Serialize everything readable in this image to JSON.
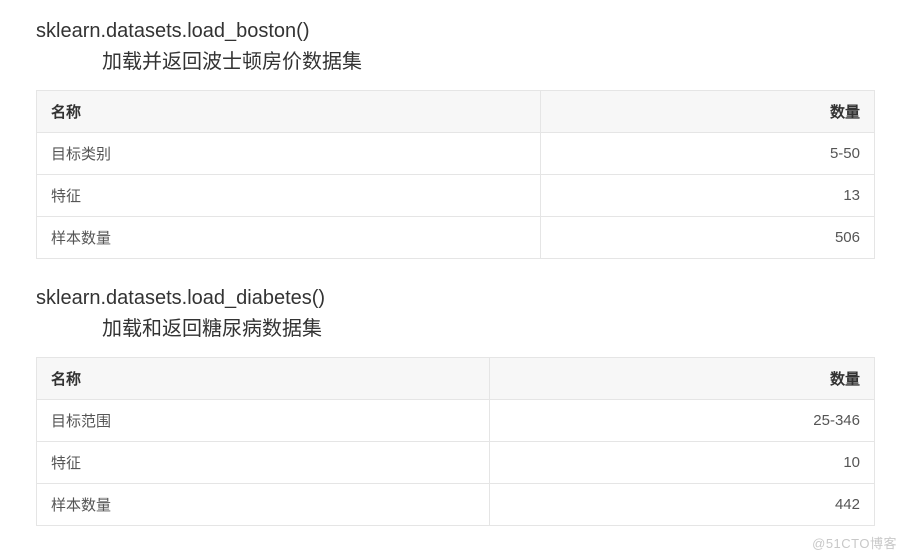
{
  "sections": [
    {
      "function": "sklearn.datasets.load_boston()",
      "description": "加载并返回波士顿房价数据集",
      "headers": {
        "name": "名称",
        "quantity": "数量"
      },
      "rows": [
        {
          "name": "目标类别",
          "value": "5-50"
        },
        {
          "name": "特征",
          "value": "13"
        },
        {
          "name": "样本数量",
          "value": "506"
        }
      ]
    },
    {
      "function": "sklearn.datasets.load_diabetes()",
      "description": "加载和返回糖尿病数据集",
      "headers": {
        "name": "名称",
        "quantity": "数量"
      },
      "rows": [
        {
          "name": "目标范围",
          "value": "25-346"
        },
        {
          "name": "特征",
          "value": "10"
        },
        {
          "name": "样本数量",
          "value": "442"
        }
      ]
    }
  ],
  "watermark": "@51CTO博客"
}
